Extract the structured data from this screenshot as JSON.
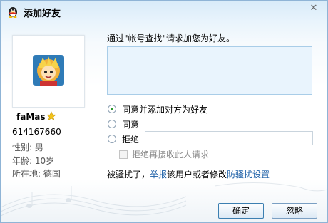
{
  "window": {
    "title": "添加好友",
    "minimize_glyph": "—",
    "close_glyph": "✕"
  },
  "profile": {
    "nickname": "faMas",
    "qq_number": "614167660",
    "gender": "性别: 男",
    "age": "年龄: 10岁",
    "location": "所在地: 德国"
  },
  "form": {
    "prompt": "通过\"帐号查找\"请求加您为好友。",
    "message_value": "",
    "options": [
      {
        "label": "同意并添加对方为好友",
        "checked": true
      },
      {
        "label": "同意",
        "checked": false
      },
      {
        "label": "拒绝",
        "checked": false
      }
    ],
    "reject_reason_value": "",
    "block_label": "拒绝再接收此人请求"
  },
  "harass": {
    "prefix": "被骚扰了，",
    "report_link": "举报",
    "middle": "该用户或者修改",
    "settings_link": "防骚扰设置"
  },
  "buttons": {
    "ok": "确定",
    "ignore": "忽略"
  },
  "colors": {
    "accent": "#1b5fa7",
    "selected_radio": "#2b9a2b"
  }
}
